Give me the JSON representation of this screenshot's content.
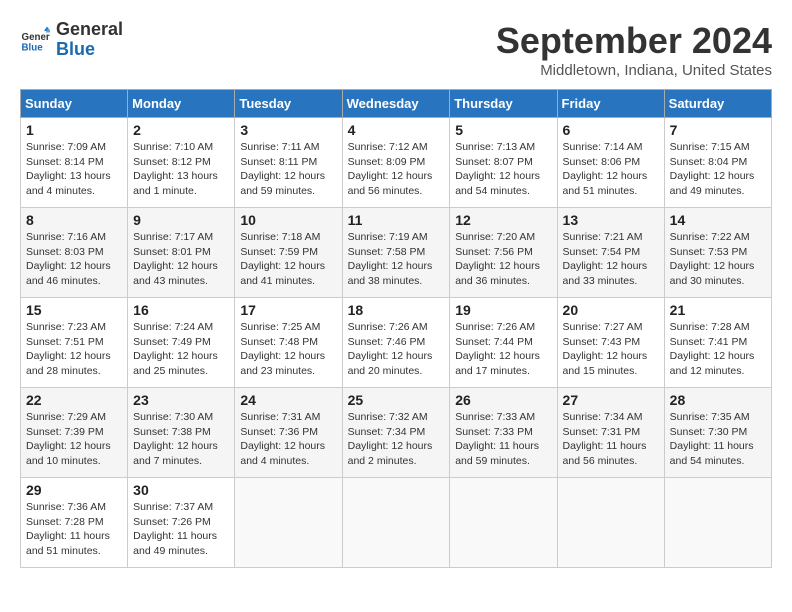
{
  "logo": {
    "line1": "General",
    "line2": "Blue"
  },
  "title": "September 2024",
  "location": "Middletown, Indiana, United States",
  "days_of_week": [
    "Sunday",
    "Monday",
    "Tuesday",
    "Wednesday",
    "Thursday",
    "Friday",
    "Saturday"
  ],
  "weeks": [
    [
      {
        "num": "1",
        "info": "Sunrise: 7:09 AM\nSunset: 8:14 PM\nDaylight: 13 hours\nand 4 minutes."
      },
      {
        "num": "2",
        "info": "Sunrise: 7:10 AM\nSunset: 8:12 PM\nDaylight: 13 hours\nand 1 minute."
      },
      {
        "num": "3",
        "info": "Sunrise: 7:11 AM\nSunset: 8:11 PM\nDaylight: 12 hours\nand 59 minutes."
      },
      {
        "num": "4",
        "info": "Sunrise: 7:12 AM\nSunset: 8:09 PM\nDaylight: 12 hours\nand 56 minutes."
      },
      {
        "num": "5",
        "info": "Sunrise: 7:13 AM\nSunset: 8:07 PM\nDaylight: 12 hours\nand 54 minutes."
      },
      {
        "num": "6",
        "info": "Sunrise: 7:14 AM\nSunset: 8:06 PM\nDaylight: 12 hours\nand 51 minutes."
      },
      {
        "num": "7",
        "info": "Sunrise: 7:15 AM\nSunset: 8:04 PM\nDaylight: 12 hours\nand 49 minutes."
      }
    ],
    [
      {
        "num": "8",
        "info": "Sunrise: 7:16 AM\nSunset: 8:03 PM\nDaylight: 12 hours\nand 46 minutes."
      },
      {
        "num": "9",
        "info": "Sunrise: 7:17 AM\nSunset: 8:01 PM\nDaylight: 12 hours\nand 43 minutes."
      },
      {
        "num": "10",
        "info": "Sunrise: 7:18 AM\nSunset: 7:59 PM\nDaylight: 12 hours\nand 41 minutes."
      },
      {
        "num": "11",
        "info": "Sunrise: 7:19 AM\nSunset: 7:58 PM\nDaylight: 12 hours\nand 38 minutes."
      },
      {
        "num": "12",
        "info": "Sunrise: 7:20 AM\nSunset: 7:56 PM\nDaylight: 12 hours\nand 36 minutes."
      },
      {
        "num": "13",
        "info": "Sunrise: 7:21 AM\nSunset: 7:54 PM\nDaylight: 12 hours\nand 33 minutes."
      },
      {
        "num": "14",
        "info": "Sunrise: 7:22 AM\nSunset: 7:53 PM\nDaylight: 12 hours\nand 30 minutes."
      }
    ],
    [
      {
        "num": "15",
        "info": "Sunrise: 7:23 AM\nSunset: 7:51 PM\nDaylight: 12 hours\nand 28 minutes."
      },
      {
        "num": "16",
        "info": "Sunrise: 7:24 AM\nSunset: 7:49 PM\nDaylight: 12 hours\nand 25 minutes."
      },
      {
        "num": "17",
        "info": "Sunrise: 7:25 AM\nSunset: 7:48 PM\nDaylight: 12 hours\nand 23 minutes."
      },
      {
        "num": "18",
        "info": "Sunrise: 7:26 AM\nSunset: 7:46 PM\nDaylight: 12 hours\nand 20 minutes."
      },
      {
        "num": "19",
        "info": "Sunrise: 7:26 AM\nSunset: 7:44 PM\nDaylight: 12 hours\nand 17 minutes."
      },
      {
        "num": "20",
        "info": "Sunrise: 7:27 AM\nSunset: 7:43 PM\nDaylight: 12 hours\nand 15 minutes."
      },
      {
        "num": "21",
        "info": "Sunrise: 7:28 AM\nSunset: 7:41 PM\nDaylight: 12 hours\nand 12 minutes."
      }
    ],
    [
      {
        "num": "22",
        "info": "Sunrise: 7:29 AM\nSunset: 7:39 PM\nDaylight: 12 hours\nand 10 minutes."
      },
      {
        "num": "23",
        "info": "Sunrise: 7:30 AM\nSunset: 7:38 PM\nDaylight: 12 hours\nand 7 minutes."
      },
      {
        "num": "24",
        "info": "Sunrise: 7:31 AM\nSunset: 7:36 PM\nDaylight: 12 hours\nand 4 minutes."
      },
      {
        "num": "25",
        "info": "Sunrise: 7:32 AM\nSunset: 7:34 PM\nDaylight: 12 hours\nand 2 minutes."
      },
      {
        "num": "26",
        "info": "Sunrise: 7:33 AM\nSunset: 7:33 PM\nDaylight: 11 hours\nand 59 minutes."
      },
      {
        "num": "27",
        "info": "Sunrise: 7:34 AM\nSunset: 7:31 PM\nDaylight: 11 hours\nand 56 minutes."
      },
      {
        "num": "28",
        "info": "Sunrise: 7:35 AM\nSunset: 7:30 PM\nDaylight: 11 hours\nand 54 minutes."
      }
    ],
    [
      {
        "num": "29",
        "info": "Sunrise: 7:36 AM\nSunset: 7:28 PM\nDaylight: 11 hours\nand 51 minutes."
      },
      {
        "num": "30",
        "info": "Sunrise: 7:37 AM\nSunset: 7:26 PM\nDaylight: 11 hours\nand 49 minutes."
      },
      null,
      null,
      null,
      null,
      null
    ]
  ]
}
